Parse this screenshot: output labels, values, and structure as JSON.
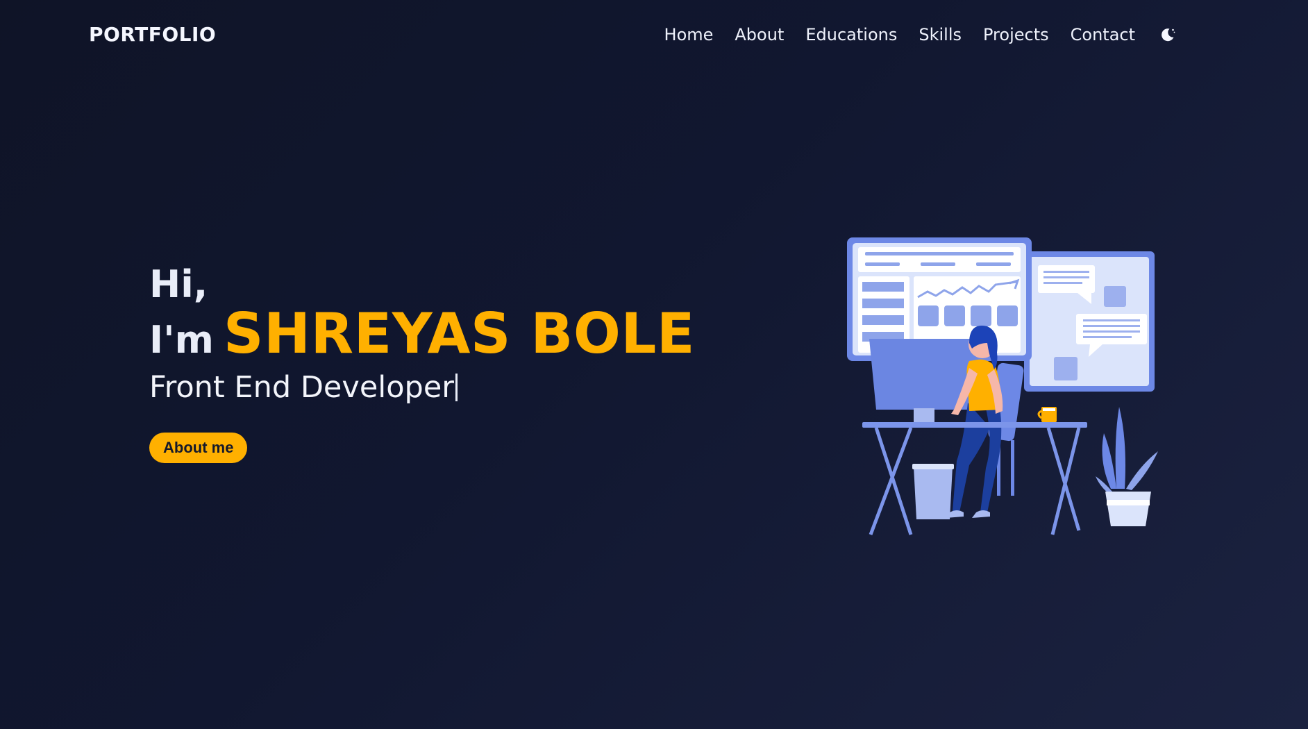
{
  "nav": {
    "logo": "PORTFOLIO",
    "links": [
      "Home",
      "About",
      "Educations",
      "Skills",
      "Projects",
      "Contact"
    ],
    "theme_toggle_icon": "moon-icon"
  },
  "hero": {
    "greeting": "Hi,",
    "im": "I'm",
    "name": "SHREYAS BOLE",
    "role": "Front End Developer",
    "button": "About me"
  },
  "colors": {
    "accent": "#ffb000",
    "background": "#111730",
    "illustration_primary": "#5b78e0",
    "illustration_light": "#dbe4fb"
  },
  "illustration_icon": "developer-at-desk-illustration"
}
